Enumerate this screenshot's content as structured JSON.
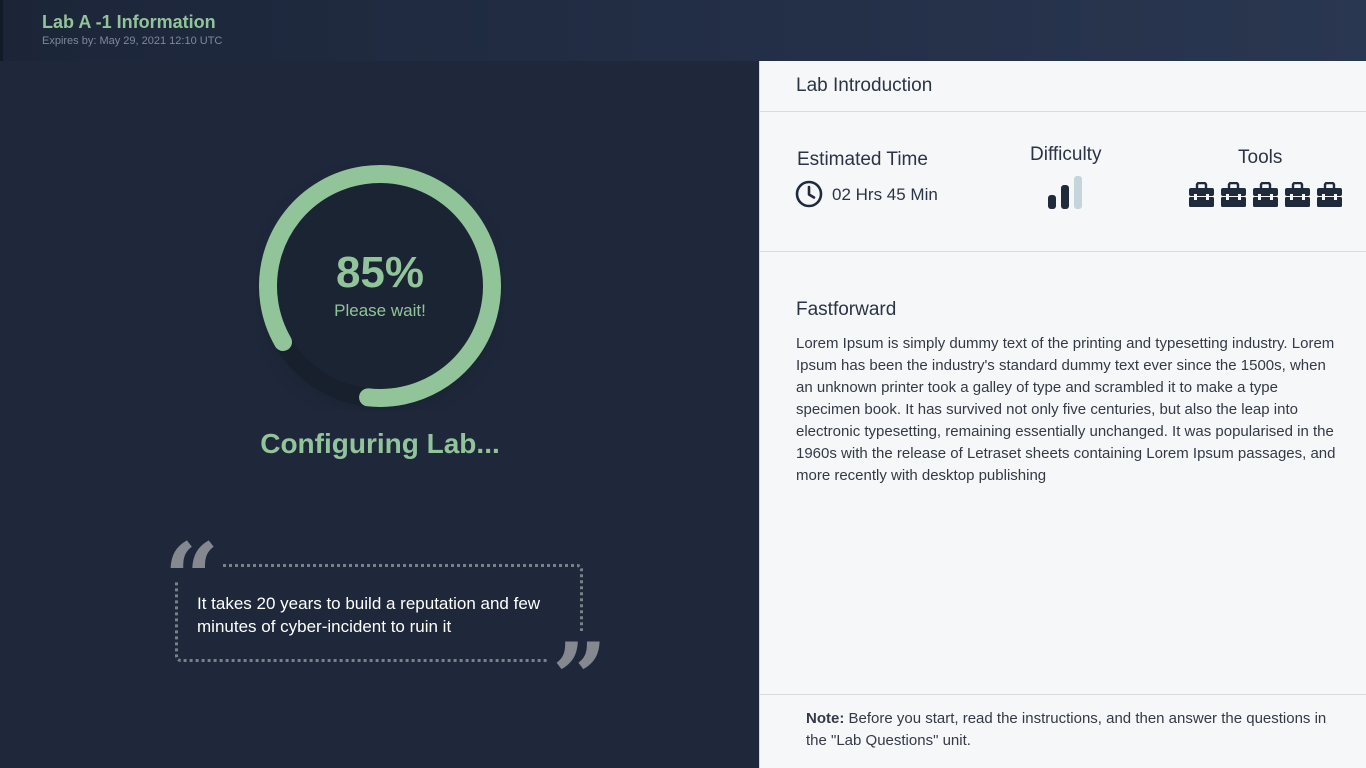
{
  "header": {
    "title": "Lab A -1 Information",
    "expires": "Expires by: May 29, 2021 12:10 UTC"
  },
  "progress": {
    "percent_text": "85%",
    "fraction": 0.85,
    "message": "Please wait!",
    "status": "Configuring Lab...",
    "color": "#92c49a"
  },
  "quote": {
    "text": "It takes 20 years to build a reputation and few minutes of cyber-incident to ruin it",
    "open_mark": "“",
    "close_mark": "”"
  },
  "intro": {
    "title": "Lab Introduction",
    "estimated_time_label": "Estimated Time",
    "estimated_time_value": "02 Hrs 45 Min",
    "difficulty_label": "Difficulty",
    "difficulty_level": 2,
    "difficulty_max": 3,
    "tools_label": "Tools",
    "tools_count": 5,
    "icons": {
      "time": "clock-icon",
      "difficulty": "signal-bars-icon",
      "tools": "toolbox-icon"
    }
  },
  "fastforward": {
    "title": "Fastforward",
    "body": "Lorem Ipsum is simply dummy text of the printing and typesetting industry. Lorem Ipsum has been the industry's standard dummy text ever since the 1500s, when an unknown printer took a galley of type and scrambled it to make a type specimen book. It has survived not only five centuries, but also the leap into electronic typesetting, remaining essentially unchanged. It was popularised in the 1960s with the release of Letraset sheets containing Lorem Ipsum passages, and more recently with desktop publishing"
  },
  "note": {
    "label": "Note:",
    "text": " Before you start, read the instructions, and then answer the questions in the \"Lab Questions\" unit."
  }
}
